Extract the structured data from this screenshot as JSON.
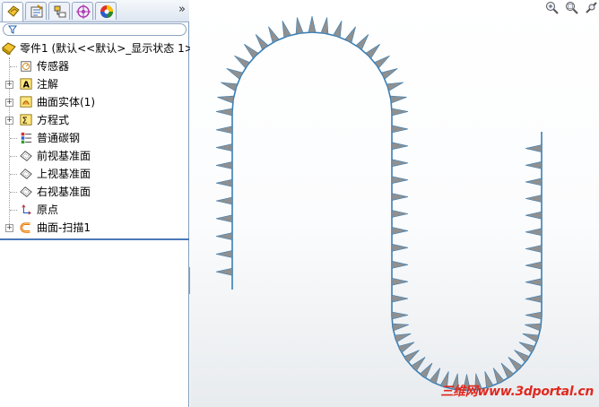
{
  "tabs": [
    {
      "icon": "feature-manager-icon"
    },
    {
      "icon": "property-manager-icon"
    },
    {
      "icon": "configuration-manager-icon"
    },
    {
      "icon": "dimxpert-icon"
    },
    {
      "icon": "display-manager-icon"
    }
  ],
  "tabs_more": "»",
  "tree": {
    "root": "零件1  (默认<<默认>_显示状态 1>",
    "items": [
      {
        "label": "传感器",
        "icon": "sensor-icon",
        "expandable": false
      },
      {
        "label": "注解",
        "icon": "annotation-icon",
        "expandable": true
      },
      {
        "label": "曲面实体(1)",
        "icon": "surface-bodies-icon",
        "expandable": true
      },
      {
        "label": "方程式",
        "icon": "equation-icon",
        "expandable": true
      },
      {
        "label": "普通碳钢",
        "icon": "material-icon",
        "expandable": false
      },
      {
        "label": "前视基准面",
        "icon": "plane-icon",
        "expandable": false
      },
      {
        "label": "上视基准面",
        "icon": "plane-icon",
        "expandable": false
      },
      {
        "label": "右视基准面",
        "icon": "plane-icon",
        "expandable": false
      },
      {
        "label": "原点",
        "icon": "origin-icon",
        "expandable": false
      },
      {
        "label": "曲面-扫描1",
        "icon": "surface-sweep-icon",
        "expandable": true
      }
    ]
  },
  "viewport_icons": [
    "zoom-to-fit-icon",
    "zoom-area-icon",
    "view-orientation-icon"
  ],
  "watermark": "三维网www.3dportal.cn",
  "colors": {
    "curve": "#3a7fb5",
    "spike": "#909090",
    "accent": "#4a78b6"
  }
}
